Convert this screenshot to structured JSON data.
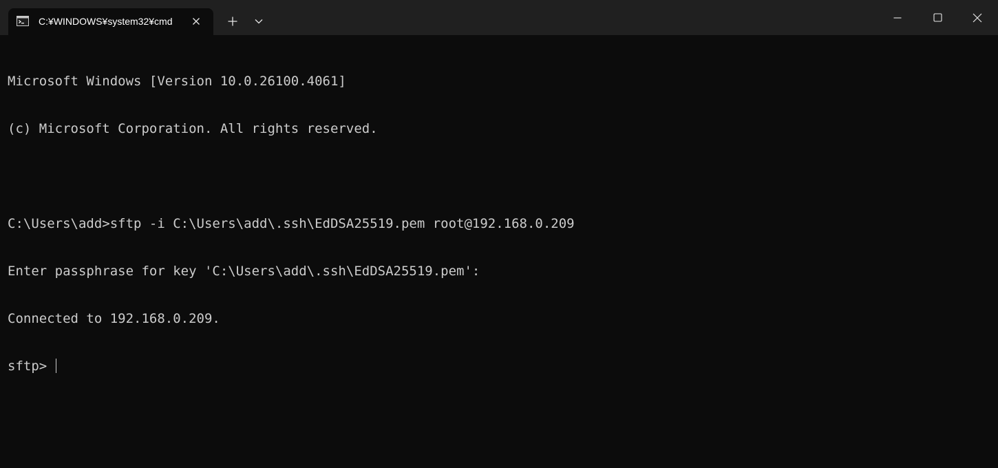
{
  "window": {
    "tab_title": "C:¥WINDOWS¥system32¥cmd",
    "icons": {
      "tab_icon": "terminal-icon",
      "tab_close": "close-icon",
      "new_tab": "plus-icon",
      "dropdown": "chevron-down-icon",
      "minimize": "minimize-icon",
      "maximize": "maximize-icon",
      "close": "close-icon"
    }
  },
  "terminal": {
    "lines": [
      "Microsoft Windows [Version 10.0.26100.4061]",
      "(c) Microsoft Corporation. All rights reserved.",
      "",
      "C:\\Users\\add>sftp -i C:\\Users\\add\\.ssh\\EdDSA25519.pem root@192.168.0.209",
      "Enter passphrase for key 'C:\\Users\\add\\.ssh\\EdDSA25519.pem':",
      "Connected to 192.168.0.209."
    ],
    "prompt": "sftp> "
  },
  "colors": {
    "titlebar": "#202020",
    "terminal_bg": "#0c0c0c",
    "terminal_fg": "#cccccc"
  }
}
